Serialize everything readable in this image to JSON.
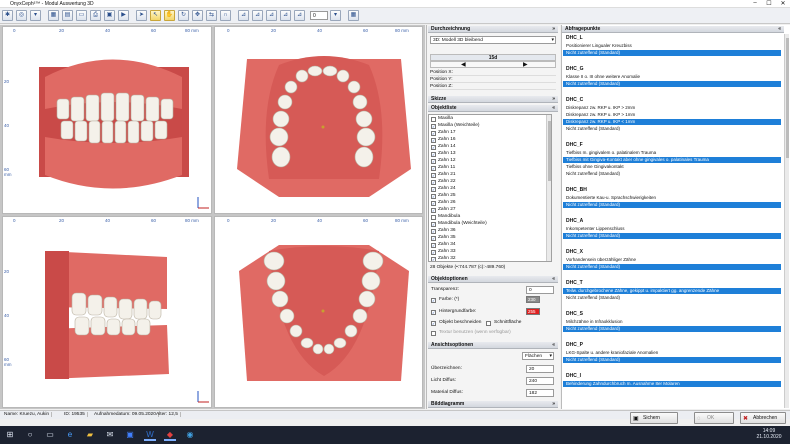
{
  "window": {
    "title": "OnyxCeph³™ - Modul Auswertung 3D",
    "minimize": "–",
    "maximize": "☐",
    "close": "✕"
  },
  "toolbar": {
    "zoom_value": "0"
  },
  "viewports": {
    "ruler_x_ticks": [
      "0",
      "20",
      "40",
      "60",
      "80 mm"
    ],
    "ruler_y_ticks": [
      "20",
      "40",
      "60 mm"
    ],
    "axis_x": "x",
    "axis_y": "y",
    "axis_z": "z"
  },
  "middle": {
    "durchzeichnung_title": "Durchzeichnung",
    "durchzeichnung_value": "3D: Modell 3D bleibend",
    "tooth_label": "15d",
    "position_x_label": "Position X:",
    "position_y_label": "Position Y:",
    "position_z_label": "Position Z:",
    "skizze_title": "Skizze",
    "objektliste_title": "Objektliste",
    "objects": [
      {
        "label": "Maxilla",
        "checked": false
      },
      {
        "label": "Maxilla (Weichteile)",
        "checked": true
      },
      {
        "label": "Zahn 17",
        "checked": true
      },
      {
        "label": "Zahn 16",
        "checked": true
      },
      {
        "label": "Zahn 14",
        "checked": true
      },
      {
        "label": "Zahn 13",
        "checked": true
      },
      {
        "label": "Zahn 12",
        "checked": true
      },
      {
        "label": "Zahn 11",
        "checked": true
      },
      {
        "label": "Zahn 21",
        "checked": true
      },
      {
        "label": "Zahn 22",
        "checked": true
      },
      {
        "label": "Zahn 24",
        "checked": true
      },
      {
        "label": "Zahn 25",
        "checked": true
      },
      {
        "label": "Zahn 26",
        "checked": true
      },
      {
        "label": "Zahn 27",
        "checked": true
      },
      {
        "label": "Mandibula",
        "checked": false
      },
      {
        "label": "Mandibula (Weichteile)",
        "checked": true
      },
      {
        "label": "Zahn 36",
        "checked": true
      },
      {
        "label": "Zahn 35",
        "checked": true
      },
      {
        "label": "Zahn 34",
        "checked": true
      },
      {
        "label": "Zahn 33",
        "checked": true
      },
      {
        "label": "Zahn 32",
        "checked": true
      }
    ],
    "objects_footer": "28 Objekte (•:744.787 (c):-489.760)",
    "objektoptionen_title": "Objektoptionen",
    "transparenz_label": "Transparenz:",
    "transparenz_value": "0",
    "farbe_label": "Farbe: (*)",
    "farbe_value": "230",
    "hintergrund_label": "Hintergrundfarbe:",
    "hintergrund_value": "255",
    "objekt_beschneiden": "Objekt beschneiden",
    "schnittflaeche": "Schnittfläche",
    "textur_label": "Textur benutzen (wenn verfügbar)",
    "ansichtsoptionen_title": "Ansichtsoptionen",
    "flaechen_value": "Flächen",
    "ueberzeichnen_label": "Überzeichnen:",
    "ueberzeichnen_value": "20",
    "licht_label": "Licht Diffus:",
    "licht_value": "240",
    "material_label": "Material Diffus:",
    "material_value": "182",
    "bilddiagramm_title": "Bilddiagramm",
    "color_fill": "#f0f0f0",
    "color_red": "#e02020"
  },
  "right": {
    "title": "Abfragepunkte",
    "items": [
      {
        "header": "DHC_L",
        "options": [
          {
            "text": "Positionierer Lingualer Kreuzbiss",
            "selected": false
          },
          {
            "text": "Nicht zutreffend (Standard)",
            "selected": true
          }
        ]
      },
      {
        "header": "DHC_G",
        "options": [
          {
            "text": "Klasse II o. III ohne weitere Anomalie",
            "selected": false
          },
          {
            "text": "Nicht zutreffend (Standard)",
            "selected": true
          }
        ]
      },
      {
        "header": "DHC_C",
        "options": [
          {
            "text": "Diskrepanz zw. RKP u. IKP > 2mm",
            "selected": false
          },
          {
            "text": "Diskrepanz zw. RKP u. IKP > 1mm",
            "selected": false
          },
          {
            "text": "Diskrepanz zw. RKP u. IKP < 1mm",
            "selected": true
          },
          {
            "text": "Nicht zutreffend (Standard)",
            "selected": false
          }
        ]
      },
      {
        "header": "DHC_F",
        "options": [
          {
            "text": "Tiefbiss m. gingivalem o. palatinalem Trauma",
            "selected": false
          },
          {
            "text": "Tiefbiss mit Gingiva-Kontakt aber ohne gingivales o. palatinales Trauma",
            "selected": true
          },
          {
            "text": "Tiefbiss ohne Gingivakontakt",
            "selected": false
          },
          {
            "text": "Nicht zutreffend (Standard)",
            "selected": false
          }
        ]
      },
      {
        "header": "DHC_BH",
        "options": [
          {
            "text": "Dokumentierte Kau-u. Sprachschwierigkeiten",
            "selected": false
          },
          {
            "text": "Nicht zutreffend (Standard)",
            "selected": true
          }
        ]
      },
      {
        "header": "DHC_A",
        "options": [
          {
            "text": "Inkompetenter Lippenschluss",
            "selected": false
          },
          {
            "text": "Nicht zutreffend (Standard)",
            "selected": true
          }
        ]
      },
      {
        "header": "DHC_X",
        "options": [
          {
            "text": "Vorhandensein überzähliger Zähne",
            "selected": false
          },
          {
            "text": "Nicht zutreffend (Standard)",
            "selected": true
          }
        ]
      },
      {
        "header": "DHC_T",
        "options": [
          {
            "text": "Teilw. durchgebrochene Zähne, gekippt u. impaktiert gg. angrenzende Zähne",
            "selected": true
          },
          {
            "text": "Nicht zutreffend (Standard)",
            "selected": false
          }
        ]
      },
      {
        "header": "DHC_S",
        "options": [
          {
            "text": "Milchzähne in Infraokklusion",
            "selected": false
          },
          {
            "text": "Nicht zutreffend (Standard)",
            "selected": true
          }
        ]
      },
      {
        "header": "DHC_P",
        "options": [
          {
            "text": "LKG-Spalte u. andere kraniofaziale Anomalien",
            "selected": false
          },
          {
            "text": "Nicht zutreffend (Standard)",
            "selected": true
          }
        ]
      },
      {
        "header": "DHC_I",
        "options": [
          {
            "text": "Behinderung Zahndurchbruch m. Ausnahme 8er Molaren",
            "selected": true
          }
        ]
      }
    ]
  },
  "status": {
    "name": "Name: Kruezu, Aukin",
    "id": "ID: 19535",
    "date": "Aufnahmedatum: 09.05.2020",
    "age": "Alter: 12,5"
  },
  "buttons": {
    "save": "Sichern",
    "ok": "OK",
    "cancel": "Abbrechen"
  },
  "taskbar": {
    "time": "14:09",
    "date": "21.10.2020"
  },
  "colors": {
    "gum": "#e06a64",
    "tooth": "#f4f1ea",
    "select": "#1e7fd8"
  }
}
